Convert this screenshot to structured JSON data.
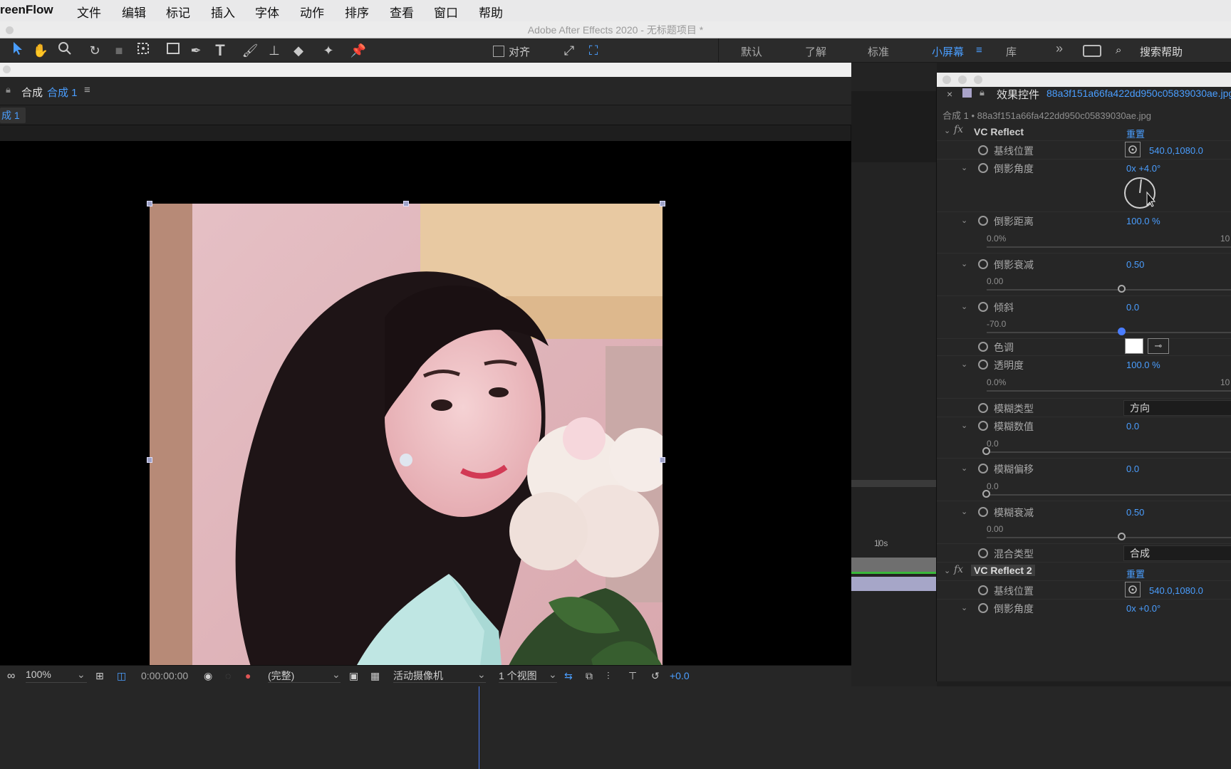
{
  "menubar": {
    "app_name": "reenFlow",
    "items": [
      "文件",
      "编辑",
      "标记",
      "插入",
      "字体",
      "动作",
      "排序",
      "查看",
      "窗口",
      "帮助"
    ]
  },
  "window_title": "Adobe After Effects 2020 - 无标题项目 *",
  "toolbar": {
    "snap_label": "对齐",
    "workspaces": [
      "默认",
      "了解",
      "标准",
      "小屏幕",
      "库"
    ],
    "active_workspace": "小屏幕",
    "search_help": "搜索帮助",
    "more_icon": "»"
  },
  "composition": {
    "panel_label": "合成",
    "comp_name": "合成 1",
    "tab_label": "成 1"
  },
  "viewer_bar": {
    "zoom": "100%",
    "timecode": "0:00:00:00",
    "resolution": "(完整)",
    "camera": "活动摄像机",
    "views": "1 个视图",
    "exposure": "+0.0"
  },
  "timeline": {
    "marker_10s": "10s"
  },
  "effect_controls": {
    "title": "效果控件",
    "file_name": "88a3f151a66fa422dd950c05839030ae.jpg",
    "layer_path": "合成 1 • 88a3f151a66fa422dd950c05839030ae.jpg",
    "effect1": {
      "name": "VC Reflect",
      "reset": "重置",
      "params": {
        "baseline": {
          "label": "基线位置",
          "value": "540.0,1080.0"
        },
        "angle": {
          "label": "倒影角度",
          "value": "0x +4.0°"
        },
        "distance": {
          "label": "倒影距离",
          "value": "100.0 %",
          "min": "0.0%",
          "max": "10"
        },
        "falloff": {
          "label": "倒影衰减",
          "value": "0.50",
          "min": "0.00",
          "level": 0.5
        },
        "skew": {
          "label": "倾斜",
          "value": "0.0",
          "min": "-70.0",
          "level": 0.5
        },
        "tint": {
          "label": "色调"
        },
        "opacity": {
          "label": "透明度",
          "value": "100.0 %",
          "min": "0.0%",
          "max": "10"
        },
        "blur_type": {
          "label": "模糊类型",
          "value": "方向"
        },
        "blur_amount": {
          "label": "模糊数值",
          "value": "0.0",
          "min": "0.0",
          "level": 0.0
        },
        "blur_offset": {
          "label": "模糊偏移",
          "value": "0.0",
          "min": "0.0",
          "level": 0.0
        },
        "blur_falloff": {
          "label": "模糊衰减",
          "value": "0.50",
          "min": "0.00",
          "level": 0.5
        },
        "blend_mode": {
          "label": "混合类型",
          "value": "合成"
        }
      }
    },
    "effect2": {
      "name": "VC Reflect 2",
      "reset": "重置",
      "params": {
        "baseline": {
          "label": "基线位置",
          "value": "540.0,1080.0"
        },
        "angle": {
          "label": "倒影角度",
          "value": "0x +0.0°"
        }
      }
    }
  },
  "colors": {
    "accent": "#4a9eff",
    "panel_bg": "#262626",
    "viewer_bg": "#000000"
  }
}
